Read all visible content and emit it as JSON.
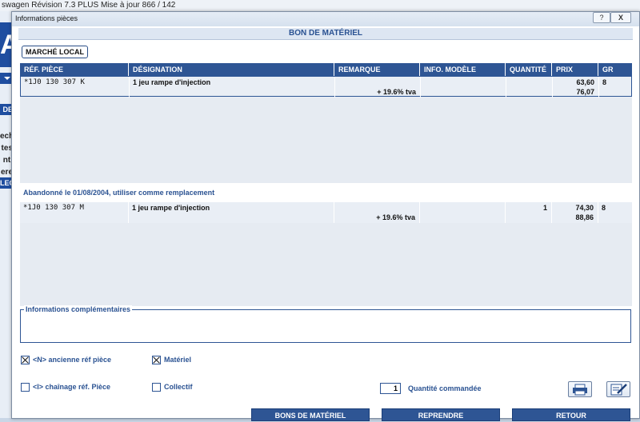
{
  "background_app": {
    "title": "swagen Révision 7.3 PLUS Mise à jour 866 / 142",
    "logo_letter": "A",
    "section_tab": "DE C",
    "sidebar_lines": [
      "ech",
      "tes",
      "nt,",
      "ere"
    ],
    "selected_item": "LEC"
  },
  "dialog": {
    "title": "Informations pièces",
    "help_label": "?",
    "close_label": "X"
  },
  "header": {
    "title": "BON DE MATÉRIEL"
  },
  "market_label": "MARCHÉ LOCAL",
  "table": {
    "columns": [
      "RÉF. PIÈCE",
      "DÉSIGNATION",
      "REMARQUE",
      "INFO. MODÈLE",
      "QUANTITÉ",
      "PRIX",
      "GR"
    ],
    "rows": [
      {
        "ref": "*1J0 130 307 K",
        "designation": "1 jeu rampe d'injection",
        "remarque": "+ 19.6% tva",
        "info": "",
        "quantite": "",
        "prix": "63,60",
        "prix_ttc": "76,07",
        "gr": "8"
      }
    ]
  },
  "replacement_note": "Abandonné le 01/08/2004, utiliser comme remplacement",
  "replacement_rows": [
    {
      "ref": "*1J0 130 307 M",
      "designation": "1 jeu rampe d'injection",
      "remarque": "+ 19.6% tva",
      "info": "",
      "quantite": "1",
      "prix": "74,30",
      "prix_ttc": "88,86",
      "gr": "8"
    }
  ],
  "info_section": {
    "label": "Informations complémentaires"
  },
  "options": {
    "ancienne_ref": {
      "label": "<N> ancienne réf pièce",
      "checked": true
    },
    "materiel": {
      "label": "Matériel",
      "checked": true
    },
    "chainage": {
      "label": "<I> chaînage réf. Pièce",
      "checked": false
    },
    "collectif": {
      "label": "Collectif",
      "checked": false
    }
  },
  "quantity": {
    "value": "1",
    "label": "Quantité commandée"
  },
  "icons": {
    "print": "printer-icon",
    "edit": "edit-document-icon"
  },
  "buttons": {
    "bons": "BONS DE MATÉRIEL",
    "reprendre": "REPRENDRE",
    "retour": "RETOUR"
  },
  "colors": {
    "accent": "#2e5594",
    "header_text": "#2a5292",
    "grid_bg": "#e6ebf2"
  }
}
